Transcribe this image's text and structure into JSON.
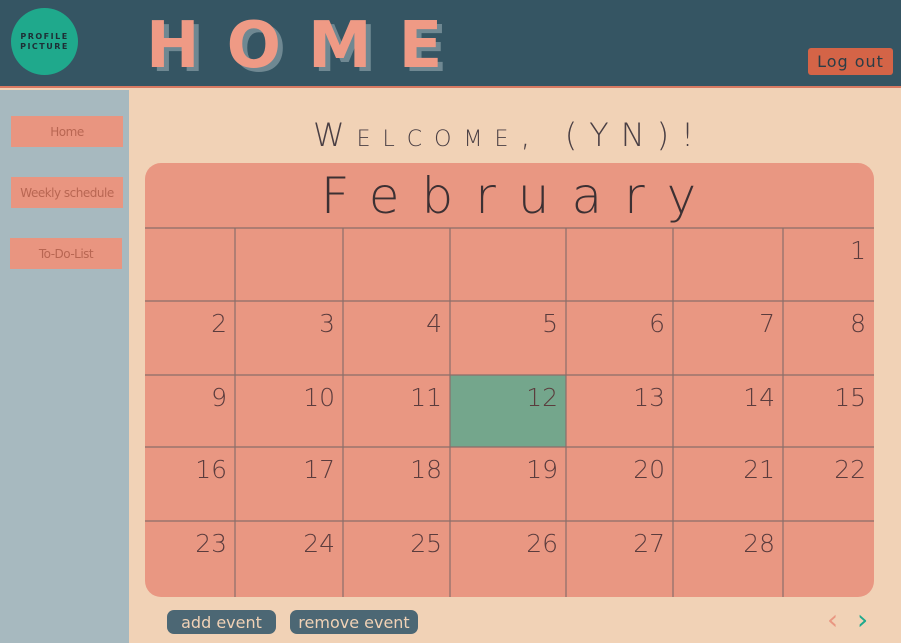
{
  "header": {
    "avatar_line1": "PROFILE",
    "avatar_line2": "PICTURE",
    "title": "HOME",
    "logout_label": "Log out"
  },
  "sidebar": {
    "items": [
      {
        "label": "Home"
      },
      {
        "label": "Weekly schedule"
      },
      {
        "label": "To-Do-List"
      }
    ]
  },
  "main": {
    "welcome": "Welcome, (YN)!",
    "calendar": {
      "month": "February",
      "today": "12",
      "weeks": [
        [
          "",
          "",
          "",
          "",
          "",
          "",
          "1"
        ],
        [
          "2",
          "3",
          "4",
          "5",
          "6",
          "7",
          "8"
        ],
        [
          "9",
          "10",
          "11",
          "12",
          "13",
          "14",
          "15"
        ],
        [
          "16",
          "17",
          "18",
          "19",
          "20",
          "21",
          "22"
        ],
        [
          "23",
          "24",
          "25",
          "26",
          "27",
          "28",
          ""
        ]
      ]
    },
    "actions": {
      "add_label": "add event",
      "remove_label": "remove event",
      "prev_icon": "chevron-left-icon",
      "next_icon": "chevron-right-icon"
    }
  },
  "colors": {
    "header_bg": "#355563",
    "sidebar_bg": "#a7b9bf",
    "page_bg": "#f1d2b6",
    "calendar_bg": "#e99782",
    "today_bg": "#74a68c",
    "accent": "#d46447",
    "avatar_bg": "#1fa98c"
  }
}
